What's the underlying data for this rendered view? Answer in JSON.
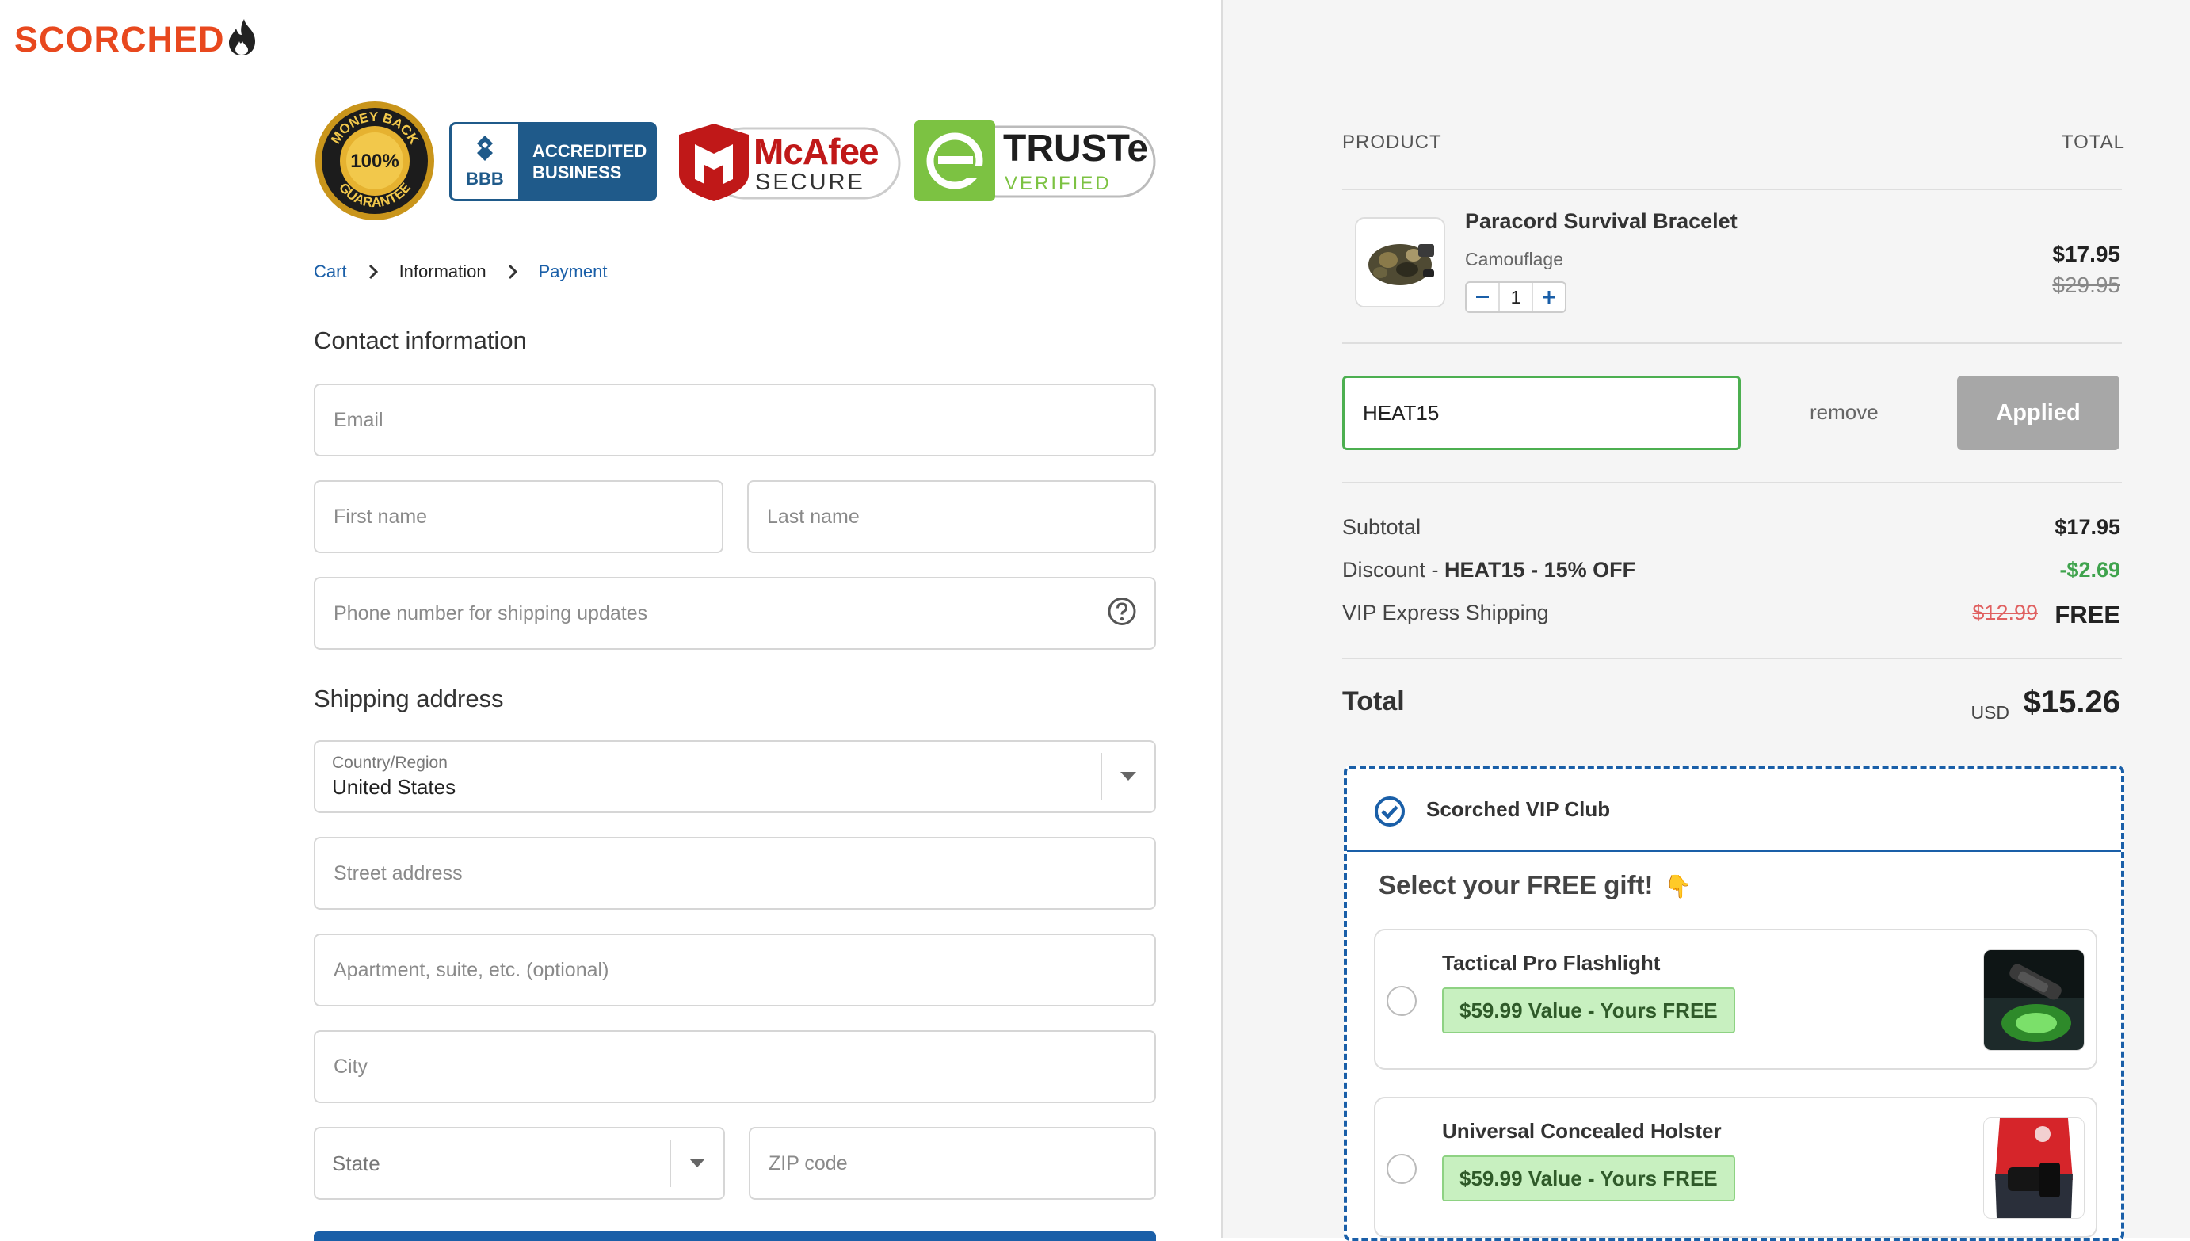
{
  "brand": {
    "name": "SCORCHED"
  },
  "badges": {
    "money_back": {
      "top": "MONEY BACK",
      "center": "100%",
      "bottom": "GUARANTEE"
    },
    "bbb": {
      "short": "BBB",
      "line1": "ACCREDITED",
      "line2": "BUSINESS"
    },
    "mcafee": {
      "name": "McAfee",
      "sub": "SECURE"
    },
    "truste": {
      "name": "TRUSTe",
      "sub": "VERIFIED"
    }
  },
  "breadcrumb": {
    "cart": "Cart",
    "information": "Information",
    "payment": "Payment"
  },
  "contact": {
    "heading": "Contact information",
    "email_placeholder": "Email",
    "first_name_placeholder": "First name",
    "last_name_placeholder": "Last name",
    "phone_placeholder": "Phone number for shipping updates"
  },
  "shipping": {
    "heading": "Shipping address",
    "country_label": "Country/Region",
    "country_value": "United States",
    "street_placeholder": "Street address",
    "apartment_placeholder": "Apartment, suite, etc. (optional)",
    "city_placeholder": "City",
    "state_label": "State",
    "zip_placeholder": "ZIP code"
  },
  "summary": {
    "product_header": "PRODUCT",
    "total_header": "TOTAL",
    "product": {
      "title": "Paracord Survival Bracelet",
      "variant": "Camouflage",
      "quantity": "1",
      "price": "$17.95",
      "compare_price": "$29.95"
    },
    "discount_code": "HEAT15",
    "remove_label": "remove",
    "applied_label": "Applied",
    "subtotal_label": "Subtotal",
    "subtotal_value": "$17.95",
    "discount_label": "Discount - ",
    "discount_code_label": "HEAT15 - 15% OFF",
    "discount_value": "-$2.69",
    "shipping_label": "VIP Express Shipping",
    "shipping_old": "$12.99",
    "shipping_value": "FREE",
    "total_label": "Total",
    "currency": "USD",
    "total_value": "$15.26"
  },
  "vip": {
    "title": "Scorched VIP Club",
    "gift_heading": "Select your FREE gift!",
    "gift_emoji": "👇",
    "gifts": [
      {
        "name": "Tactical Pro Flashlight",
        "badge": "$59.99 Value - Yours FREE"
      },
      {
        "name": "Universal Concealed Holster",
        "badge": "$59.99 Value - Yours FREE"
      }
    ]
  },
  "colors": {
    "brand": "#e8481e",
    "link": "#1a5fa8",
    "success": "#3fa34d",
    "badge_bg": "#c8f0c0"
  }
}
